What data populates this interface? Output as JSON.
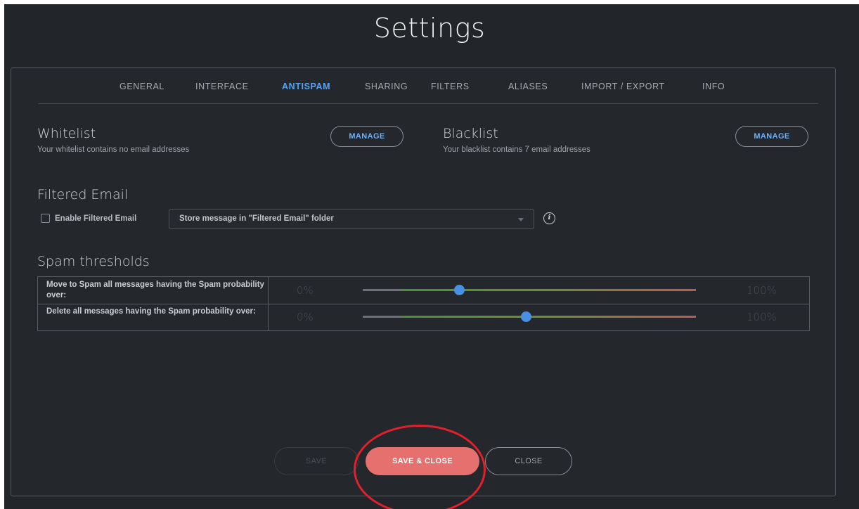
{
  "title": "Settings",
  "tabs": [
    {
      "label": "GENERAL"
    },
    {
      "label": "INTERFACE"
    },
    {
      "label": "ANTISPAM"
    },
    {
      "label": "SHARING"
    },
    {
      "label": "FILTERS"
    },
    {
      "label": "ALIASES"
    },
    {
      "label": "IMPORT / EXPORT"
    },
    {
      "label": "INFO"
    }
  ],
  "active_tab": "ANTISPAM",
  "whitelist": {
    "title": "Whitelist",
    "subtitle": "Your whitelist contains no email addresses",
    "button": "MANAGE"
  },
  "blacklist": {
    "title": "Blacklist",
    "subtitle": "Your blacklist contains 7 email addresses",
    "button": "MANAGE"
  },
  "filtered_email": {
    "title": "Filtered Email",
    "checkbox_label": "Enable Filtered Email",
    "checked": false,
    "select_value": "Store message in \"Filtered Email\" folder",
    "info_icon": "info-icon"
  },
  "spam_thresholds": {
    "title": "Spam thresholds",
    "rows": [
      {
        "label": "Move to Spam all messages having the Spam probability over:",
        "min_label": "0%",
        "max_label": "100%",
        "value": 0.29
      },
      {
        "label": "Delete all messages having the Spam probability over:",
        "min_label": "0%",
        "max_label": "100%",
        "value": 0.49
      }
    ]
  },
  "footer": {
    "save": "SAVE",
    "save_close": "SAVE & CLOSE",
    "close": "CLOSE"
  },
  "colors": {
    "accent": "#5aa3f0",
    "primary_button": "#e6706e",
    "annotation": "#e0202a",
    "background": "#22252a"
  }
}
